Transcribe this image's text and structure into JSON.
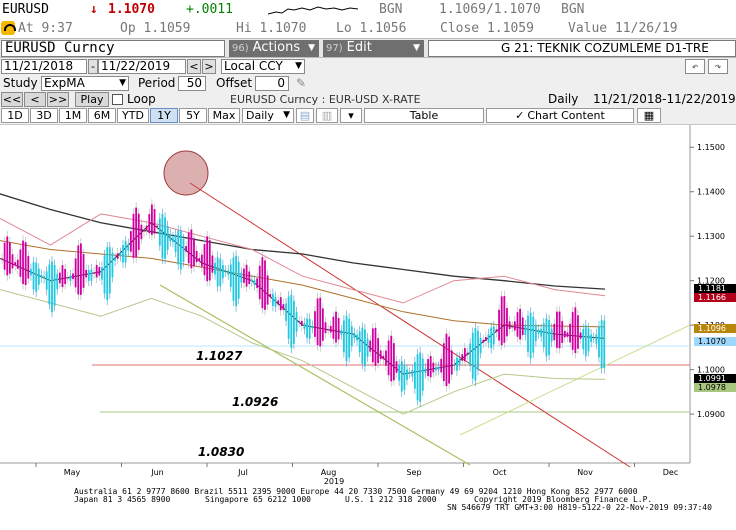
{
  "quote": {
    "ticker": "EURUSD",
    "arrow": "↓",
    "last": "1.1070",
    "change": "+.0011",
    "source1": "BGN",
    "bid_ask": "1.1069/1.1070",
    "source2": "BGN"
  },
  "stats": {
    "at": "At 9:37",
    "open": "Op 1.1059",
    "high": "Hi 1.1070",
    "low": "Lo 1.1056",
    "close": "Close 1.1059",
    "value": "Value 11/26/19"
  },
  "toolbar": {
    "security": "EURUSD  Curncy",
    "actions_num": "96)",
    "actions_label": "Actions",
    "edit_num": "97)",
    "edit_label": "Edit",
    "title": "G 21: TEKNIK COZUMLEME D1-TRE"
  },
  "daterange": {
    "start": "11/21/2018",
    "end": "11/22/2019",
    "currency": "Local CCY"
  },
  "study": {
    "study_label": "Study",
    "study_value": "ExpMA",
    "period_label": "Period",
    "period_value": "50",
    "offset_label": "Offset",
    "offset_value": "0"
  },
  "play": {
    "rew2": "<<",
    "rew1": "<",
    "fwd": ">>",
    "play": "Play",
    "loop": "Loop",
    "security_desc": "EURUSD  Curncy : EUR-USD X-RATE",
    "freq": "Daily",
    "period": "11/21/2018-11/22/2019"
  },
  "range": {
    "buttons": [
      "1D",
      "3D",
      "1M",
      "6M",
      "YTD",
      "1Y",
      "5Y",
      "Max"
    ],
    "selected": "1Y",
    "freq": "Daily",
    "table": "Table",
    "chart_content": "Chart Content"
  },
  "chart_data": {
    "type": "line",
    "ylim": [
      1.079,
      1.155
    ],
    "y_ticks": [
      "1.1500",
      "1.1400",
      "1.1300",
      "1.1200",
      "1.1100",
      "1.1000",
      "1.0900"
    ],
    "x_ticks": [
      "May",
      "Jun",
      "Jul",
      "Aug",
      "Sep",
      "Oct",
      "Nov",
      "Dec"
    ],
    "year_label": "2019",
    "level_labels": [
      "1.1027",
      "1.0926",
      "1.0830"
    ],
    "price_tags": [
      {
        "label": "1.1181",
        "color": "#000000"
      },
      {
        "label": "1.1166",
        "color": "#b3001b"
      },
      {
        "label": "1.1096",
        "color": "#b8860b"
      },
      {
        "label": "1.1070",
        "color": "#9fd8ff"
      },
      {
        "label": "1.0991",
        "color": "#000000"
      },
      {
        "label": "1.0978",
        "color": "#a8c880"
      }
    ],
    "series": [
      {
        "color": "#333333",
        "values": [
          1.1395,
          1.136,
          1.133,
          1.131,
          1.129,
          1.127,
          1.126,
          1.124,
          1.1225,
          1.121,
          1.12,
          1.1188,
          1.1181
        ]
      },
      {
        "color": "#b07028",
        "values": [
          1.129,
          1.127,
          1.126,
          1.125,
          1.123,
          1.121,
          1.119,
          1.116,
          1.113,
          1.111,
          1.11,
          1.1098,
          1.1096
        ]
      },
      {
        "color": "#e08890",
        "values": [
          1.134,
          1.128,
          1.135,
          1.133,
          1.13,
          1.127,
          1.121,
          1.118,
          1.115,
          1.12,
          1.121,
          1.118,
          1.1166
        ]
      },
      {
        "color": "#b5c98a",
        "values": [
          1.118,
          1.115,
          1.112,
          1.116,
          1.112,
          1.106,
          1.102,
          1.096,
          1.09,
          1.095,
          1.099,
          1.098,
          1.0978
        ]
      },
      {
        "color": "#202020",
        "values": [
          1.125,
          1.12,
          1.122,
          1.133,
          1.124,
          1.12,
          1.11,
          1.108,
          1.099,
          1.101,
          1.11,
          1.108,
          1.107
        ]
      }
    ]
  },
  "footer": {
    "line1": "Australia 61 2 9777 8600 Brazil 5511 2395 9000 Europe 44 20 7330 7500 Germany 49 69 9204 1210 Hong Kong 852 2977 6000",
    "line2a": "Japan 81 3 4565 8900",
    "line2b": "Singapore 65 6212 1000",
    "line2c": "U.S. 1 212 318 2000",
    "line2d": "Copyright 2019 Bloomberg Finance L.P.",
    "line3": "SN 546679 TRT  GMT+3:00 H819-5122-0 22-Nov-2019 09:37:40"
  }
}
